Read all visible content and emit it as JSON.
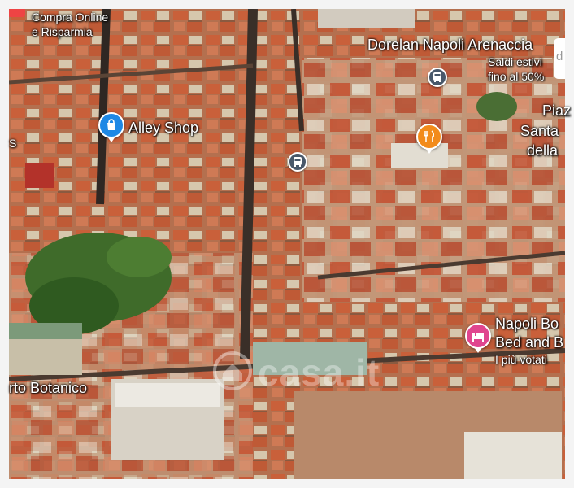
{
  "map": {
    "type": "satellite-3d",
    "colors": {
      "roof": "#c4643e",
      "wall": "#d9c6a7",
      "street": "#3b3129",
      "trees": "#3f6b2a",
      "pin_blue": "#1e88e5",
      "pin_orange": "#f28b1b",
      "pin_pink": "#e0458f",
      "transit": "#48586a"
    }
  },
  "labels": {
    "promo_title": "Compra Online",
    "promo_sub": "e Risparmia",
    "dorelan": "Dorelan Napoli Arenaccia",
    "saldi_1": "Saldi estivi",
    "saldi_2": "fino al 50%",
    "piazza_1": "Piaz",
    "piazza_2": "Santa",
    "piazza_3": "della",
    "alley": "Alley Shop",
    "napoli_bnb_1": "Napoli Bo",
    "napoli_bnb_2": "Bed and B",
    "napoli_bnb_3": "I più votati",
    "orto": "rto Botanico",
    "left_edge_s": "S"
  },
  "watermark": {
    "text": "casa.it"
  },
  "icons": {
    "shop": "shopping-bag-icon",
    "restaurant": "fork-knife-icon",
    "hotel": "bed-icon",
    "transit": "bus-icon",
    "edge": "d"
  }
}
